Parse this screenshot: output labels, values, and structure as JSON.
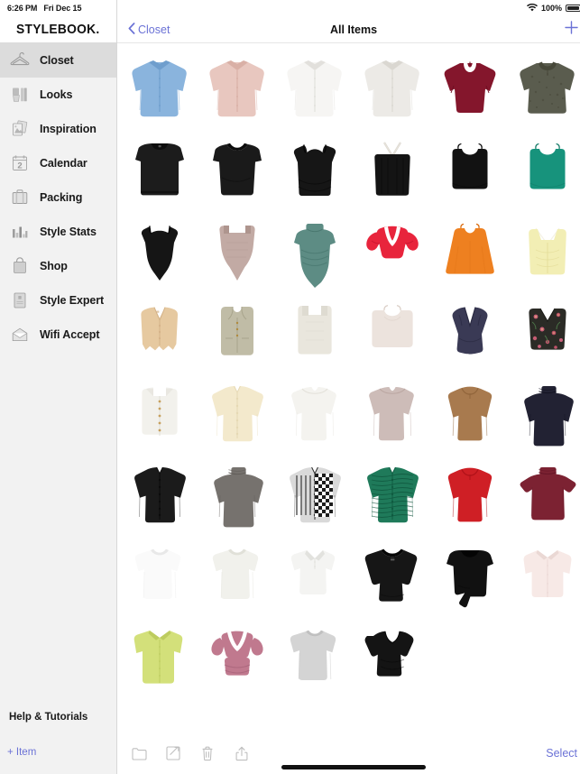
{
  "status_bar": {
    "time": "6:26 PM",
    "date": "Fri Dec 15",
    "wifi_icon": "wifi-icon",
    "battery_percent": "100%",
    "battery_icon": "battery-full-icon"
  },
  "sidebar": {
    "brand": "STYLEBOOK.",
    "items": [
      {
        "label": "Closet",
        "icon": "hanger-icon",
        "active": true
      },
      {
        "label": "Looks",
        "icon": "outfit-icon",
        "active": false
      },
      {
        "label": "Inspiration",
        "icon": "photos-icon",
        "active": false
      },
      {
        "label": "Calendar",
        "icon": "calendar-icon",
        "active": false
      },
      {
        "label": "Packing",
        "icon": "suitcase-icon",
        "active": false
      },
      {
        "label": "Style Stats",
        "icon": "bar-chart-icon",
        "active": false
      },
      {
        "label": "Shop",
        "icon": "shopping-bag-icon",
        "active": false
      },
      {
        "label": "Style Expert",
        "icon": "book-icon",
        "active": false
      },
      {
        "label": "Wifi Accept",
        "icon": "envelope-icon",
        "active": false
      }
    ],
    "help_label": "Help & Tutorials",
    "add_item_label": "+ Item"
  },
  "navbar": {
    "back_label": "Closet",
    "back_icon": "chevron-left-icon",
    "title": "All Items",
    "add_icon": "plus-icon"
  },
  "toolbar": {
    "buttons": [
      {
        "icon": "folder-icon",
        "name": "folder-button"
      },
      {
        "icon": "edit-icon",
        "name": "edit-button"
      },
      {
        "icon": "trash-icon",
        "name": "delete-button"
      },
      {
        "icon": "share-icon",
        "name": "share-button"
      }
    ],
    "select_label": "Select"
  },
  "colors": {
    "accent": "#6b72d6",
    "sidebar_bg": "#f2f2f2",
    "active_row": "#dcdcdc",
    "text": "#1a1a1a"
  },
  "grid": {
    "columns": 6,
    "rows": 8,
    "total_items": 46,
    "items": [
      {
        "name": "light-blue-button-up-shirt",
        "type": "buttonshirt",
        "color": "#8ab4dd",
        "shade": "#6f9ecd"
      },
      {
        "name": "pink-button-up-shirt",
        "type": "buttonshirt",
        "color": "#e8c7bf",
        "shade": "#d9b0a6"
      },
      {
        "name": "white-silk-blouse",
        "type": "buttonshirt",
        "color": "#f6f5f3",
        "shade": "#e2e0dc"
      },
      {
        "name": "white-collared-blouse",
        "type": "buttonshirt",
        "color": "#eceae6",
        "shade": "#dad7d1"
      },
      {
        "name": "burgundy-keyhole-top",
        "type": "keyhole",
        "color": "#84162c",
        "shade": "#6d0f22"
      },
      {
        "name": "dark-floral-print-blouse",
        "type": "peasant",
        "color": "#5a5c4e",
        "shade": "#474839"
      },
      {
        "name": "black-sleeveless-mock-neck",
        "type": "muscletank",
        "color": "#1c1c1c",
        "shade": "#0d0d0d"
      },
      {
        "name": "black-scoop-neck-tank",
        "type": "scooptank",
        "color": "#1a1a1a",
        "shade": "#0c0c0c"
      },
      {
        "name": "black-camisole",
        "type": "camisole",
        "color": "#161616",
        "shade": "#070707"
      },
      {
        "name": "black-strappy-cami",
        "type": "strappycami",
        "color": "#141414",
        "shade": "#060606"
      },
      {
        "name": "black-crop-top",
        "type": "croptop",
        "color": "#121212",
        "shade": "#050505"
      },
      {
        "name": "teal-halter-crop-top",
        "type": "croptop",
        "color": "#17937c",
        "shade": "#0f7864"
      },
      {
        "name": "black-bodysuit",
        "type": "bodysuit",
        "color": "#151515",
        "shade": "#060606"
      },
      {
        "name": "taupe-square-neck-bodysuit",
        "type": "bodysuit2",
        "color": "#c2aaa4",
        "shade": "#ae958e"
      },
      {
        "name": "sage-ruched-bodysuit",
        "type": "ruchedbody",
        "color": "#5d8c84",
        "shade": "#4a7870"
      },
      {
        "name": "red-puff-sleeve-top",
        "type": "puffsleeve",
        "color": "#e8243c",
        "shade": "#cc1630"
      },
      {
        "name": "orange-flowy-tank",
        "type": "flowytank",
        "color": "#ee8020",
        "shade": "#d96c10"
      },
      {
        "name": "pale-yellow-ruched-tank",
        "type": "ruchedtank",
        "color": "#f2eeb4",
        "shade": "#e4dd99"
      },
      {
        "name": "tan-knit-vest",
        "type": "vest",
        "color": "#e6c9a0",
        "shade": "#d4b288"
      },
      {
        "name": "olive-linen-vest",
        "type": "longvest",
        "color": "#c0bca6",
        "shade": "#a8a48c"
      },
      {
        "name": "cream-square-neck-tank",
        "type": "squaretank",
        "color": "#e9e6dd",
        "shade": "#d6d2c6"
      },
      {
        "name": "blush-crop-tank",
        "type": "croptank",
        "color": "#ece3dd",
        "shade": "#dbcfc7"
      },
      {
        "name": "navy-draped-top",
        "type": "draped",
        "color": "#3a3a55",
        "shade": "#2a2a42"
      },
      {
        "name": "black-floral-embroidered-top",
        "type": "floralcrop",
        "color": "#2b2b26",
        "shade": "#1a1a16"
      },
      {
        "name": "white-button-front-tank",
        "type": "buttontank",
        "color": "#f2f1ec",
        "shade": "#e0ded6"
      },
      {
        "name": "cream-ribbed-cardigan",
        "type": "cardigan",
        "color": "#f3e9cc",
        "shade": "#e6d9b4"
      },
      {
        "name": "white-sweetheart-top",
        "type": "sweetheart",
        "color": "#f4f3ef",
        "shade": "#e3e1da"
      },
      {
        "name": "mauve-square-neck-top",
        "type": "sweetheart",
        "color": "#cdbcb8",
        "shade": "#bba7a2"
      },
      {
        "name": "camel-split-neck-sweater",
        "type": "sweater",
        "color": "#a87a4e",
        "shade": "#92663c"
      },
      {
        "name": "navy-turtleneck-sweater",
        "type": "turtleneck",
        "color": "#222233",
        "shade": "#131321"
      },
      {
        "name": "black-button-cardigan",
        "type": "cardigan",
        "color": "#1b1b1b",
        "shade": "#0b0b0b"
      },
      {
        "name": "grey-mock-neck-sweater",
        "type": "turtleneck",
        "color": "#76726e",
        "shade": "#625e5a"
      },
      {
        "name": "checkered-patchwork-cardigan",
        "type": "cardigan",
        "color": "#d9d9d9",
        "shade": "#2a2a2a"
      },
      {
        "name": "green-textured-cardigan",
        "type": "cardigan",
        "color": "#1f7a5a",
        "shade": "#0f5d42"
      },
      {
        "name": "red-crew-neck-sweater",
        "type": "sweater",
        "color": "#cf1f25",
        "shade": "#b21219"
      },
      {
        "name": "burgundy-short-sleeve-turtleneck",
        "type": "ssturtle",
        "color": "#7c2232",
        "shade": "#651627"
      },
      {
        "name": "white-crew-neck-tee",
        "type": "tee",
        "color": "#fafafa",
        "shade": "#e8e8e8"
      },
      {
        "name": "white-boxy-blouse",
        "type": "tee",
        "color": "#f1f1ec",
        "shade": "#e0e0d8"
      },
      {
        "name": "white-polo-shirt",
        "type": "polo",
        "color": "#f4f4f2",
        "shade": "#e2e2de"
      },
      {
        "name": "black-three-quarter-sleeve-top",
        "type": "threequarter",
        "color": "#161616",
        "shade": "#070707"
      },
      {
        "name": "black-tie-waist-top",
        "type": "tiewaist",
        "color": "#111111",
        "shade": "#040404"
      },
      {
        "name": "pale-pink-boxy-shirt",
        "type": "boxyshirt",
        "color": "#f7e9e6",
        "shade": "#ead8d4"
      },
      {
        "name": "lime-green-camp-shirt",
        "type": "campshirt",
        "color": "#d3e07a",
        "shade": "#bdcc5f"
      },
      {
        "name": "pink-ruffled-peplum-top",
        "type": "ruffle",
        "color": "#c0798e",
        "shade": "#a8647a"
      },
      {
        "name": "grey-crew-neck-tee",
        "type": "tee",
        "color": "#d4d4d4",
        "shade": "#c0c0c0"
      },
      {
        "name": "black-wrap-crop-top",
        "type": "wrapcrop",
        "color": "#141414",
        "shade": "#050505"
      }
    ]
  }
}
